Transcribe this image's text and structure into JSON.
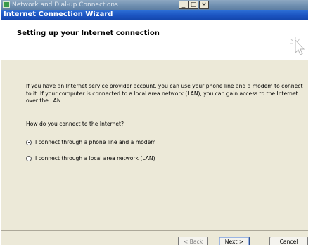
{
  "background_window": {
    "title": "Network and Dial-up Connections",
    "minimize_glyph": "_",
    "maximize_glyph": "□",
    "close_glyph": "×"
  },
  "wizard": {
    "title": "Internet Connection Wizard",
    "header_title": "Setting up your Internet connection",
    "intro_text": "If you have an Internet service provider account, you can use your phone line and a modem to connect to it. If your computer is connected to a local area network (LAN), you can gain access to the Internet over the LAN.",
    "question": "How do you connect to the Internet?",
    "options": [
      {
        "label": "I connect through a phone line and a modem",
        "selected": true
      },
      {
        "label": "I connect through a local area network (LAN)",
        "selected": false
      }
    ],
    "buttons": {
      "back": "< Back",
      "next": "Next >",
      "cancel": "Cancel"
    }
  },
  "icons": {
    "header_icon": "cursor-icon",
    "app_icon": "network-connections-icon"
  },
  "colors": {
    "wizard_titlebar": "#1b53c0",
    "background_titlebar": "#6f8fb0",
    "dialog_face": "#ece9d8",
    "header_background": "#ffffff"
  }
}
